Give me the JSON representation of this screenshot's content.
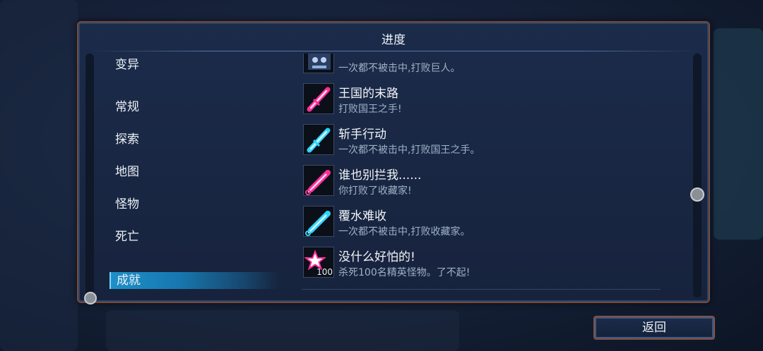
{
  "panel": {
    "title": "进度"
  },
  "categories": [
    {
      "label": "变异"
    },
    {
      "label": "常规"
    },
    {
      "label": "探索"
    },
    {
      "label": "地图"
    },
    {
      "label": "怪物"
    },
    {
      "label": "死亡"
    },
    {
      "label": "成就"
    }
  ],
  "achievements": [
    {
      "name": "",
      "desc": "一次都不被击中,打败巨人。",
      "icon": "giant-achievement-icon",
      "color": "#5b7fb7"
    },
    {
      "name": "王国的末路",
      "desc": "打败国王之手!",
      "icon": "sword-icon",
      "color": "#ff2f9a"
    },
    {
      "name": "斩手行动",
      "desc": "一次都不被击中,打败国王之手。",
      "icon": "sword-icon",
      "color": "#2fd3ff"
    },
    {
      "name": "谁也别拦我......",
      "desc": "你打败了收藏家!",
      "icon": "syringe-icon",
      "color": "#ff2f9a"
    },
    {
      "name": "覆水难收",
      "desc": "一次都不被击中,打败收藏家。",
      "icon": "syringe-icon",
      "color": "#2fd3ff"
    },
    {
      "name": "没什么好怕的!",
      "desc": "杀死100名精英怪物。了不起!",
      "icon": "star-icon",
      "color": "#ff2f9a",
      "badge": "100"
    }
  ],
  "footer": {
    "back_label": "返回"
  }
}
